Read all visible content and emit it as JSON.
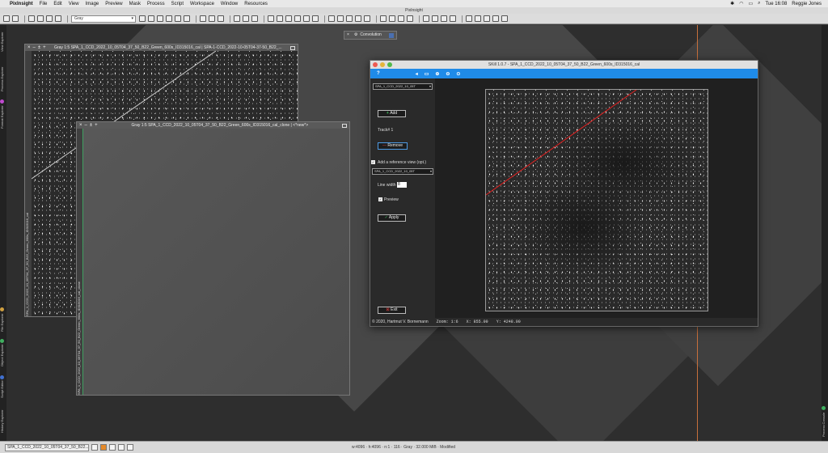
{
  "menubar": {
    "app": "PixInsight",
    "items": [
      "File",
      "Edit",
      "View",
      "Image",
      "Preview",
      "Mask",
      "Process",
      "Script",
      "Workspace",
      "Window",
      "Resources"
    ],
    "time": "Tue 16:08",
    "user": "Reggie Jones"
  },
  "app_title": "PixInsight",
  "toolbar": {
    "view_select": "Gray"
  },
  "sidebar_left": [
    "View Explorer",
    "Process Explorer",
    "Format Explorer",
    "File Explorer",
    "Object Explorer",
    "Script Editor",
    "History Explorer"
  ],
  "sidebar_right": [
    "Process Console"
  ],
  "windows": {
    "back": {
      "title": "Gray 1:5 SPA_1_CCD_2022_10_05T04_37_50_B22_Green_600s_ID315016_cal | SPA-1-CCD_2022-10-05T04-37-50_B22_...",
      "side_label": "SPA_1_CCD_2022_10_05T04_37_50_B22_Green_600s_ID315016_cal"
    },
    "front": {
      "title": "Gray 1:5 SPA_1_CCD_2022_10_05T04_37_50_B22_Green_600s_ID315016_cal_clone | <*new*>",
      "side_label": "SPA_1_CCD_2022_10_05T04_37_50_B22_Green_600s_ID315016_cal_clone"
    }
  },
  "convolution": {
    "label": "Convolution"
  },
  "skill": {
    "title": "SKill 1.0.7 - SPA_1_CCD_2022_10_05T04_37_50_B22_Green_600s_ID315016_cal",
    "help": "?",
    "view_select": "SPA_1_CCD_2022_10_05T",
    "add_label": "Add",
    "track_label": "Track# 1",
    "remove_label": "Remove",
    "ref_label": "Add a reference view (opt.)",
    "ref_select": "SPA_1_CCD_2022_10_05T",
    "line_width_label": "Line width",
    "line_width_value": "8",
    "preview_label": "Preview",
    "apply_label": "Apply",
    "exit_label": "Exit",
    "copyright": "© 2020, Hartmut V. Bornemann",
    "zoom": "Zoom: 1:6",
    "x": "X:   855.00",
    "y": "Y:  4248.00",
    "line_color": "#e02020"
  },
  "bottombar": {
    "view_select": "SPA_1_CCD_2022_10_05T04_37_50_B22...",
    "info": "w:4096 · h:4096 · n:1 · 116 · Gray · 32.000 MiB · Modified"
  },
  "colors": {
    "accent": "#1f8be8",
    "guide_line": "#c8703c"
  }
}
